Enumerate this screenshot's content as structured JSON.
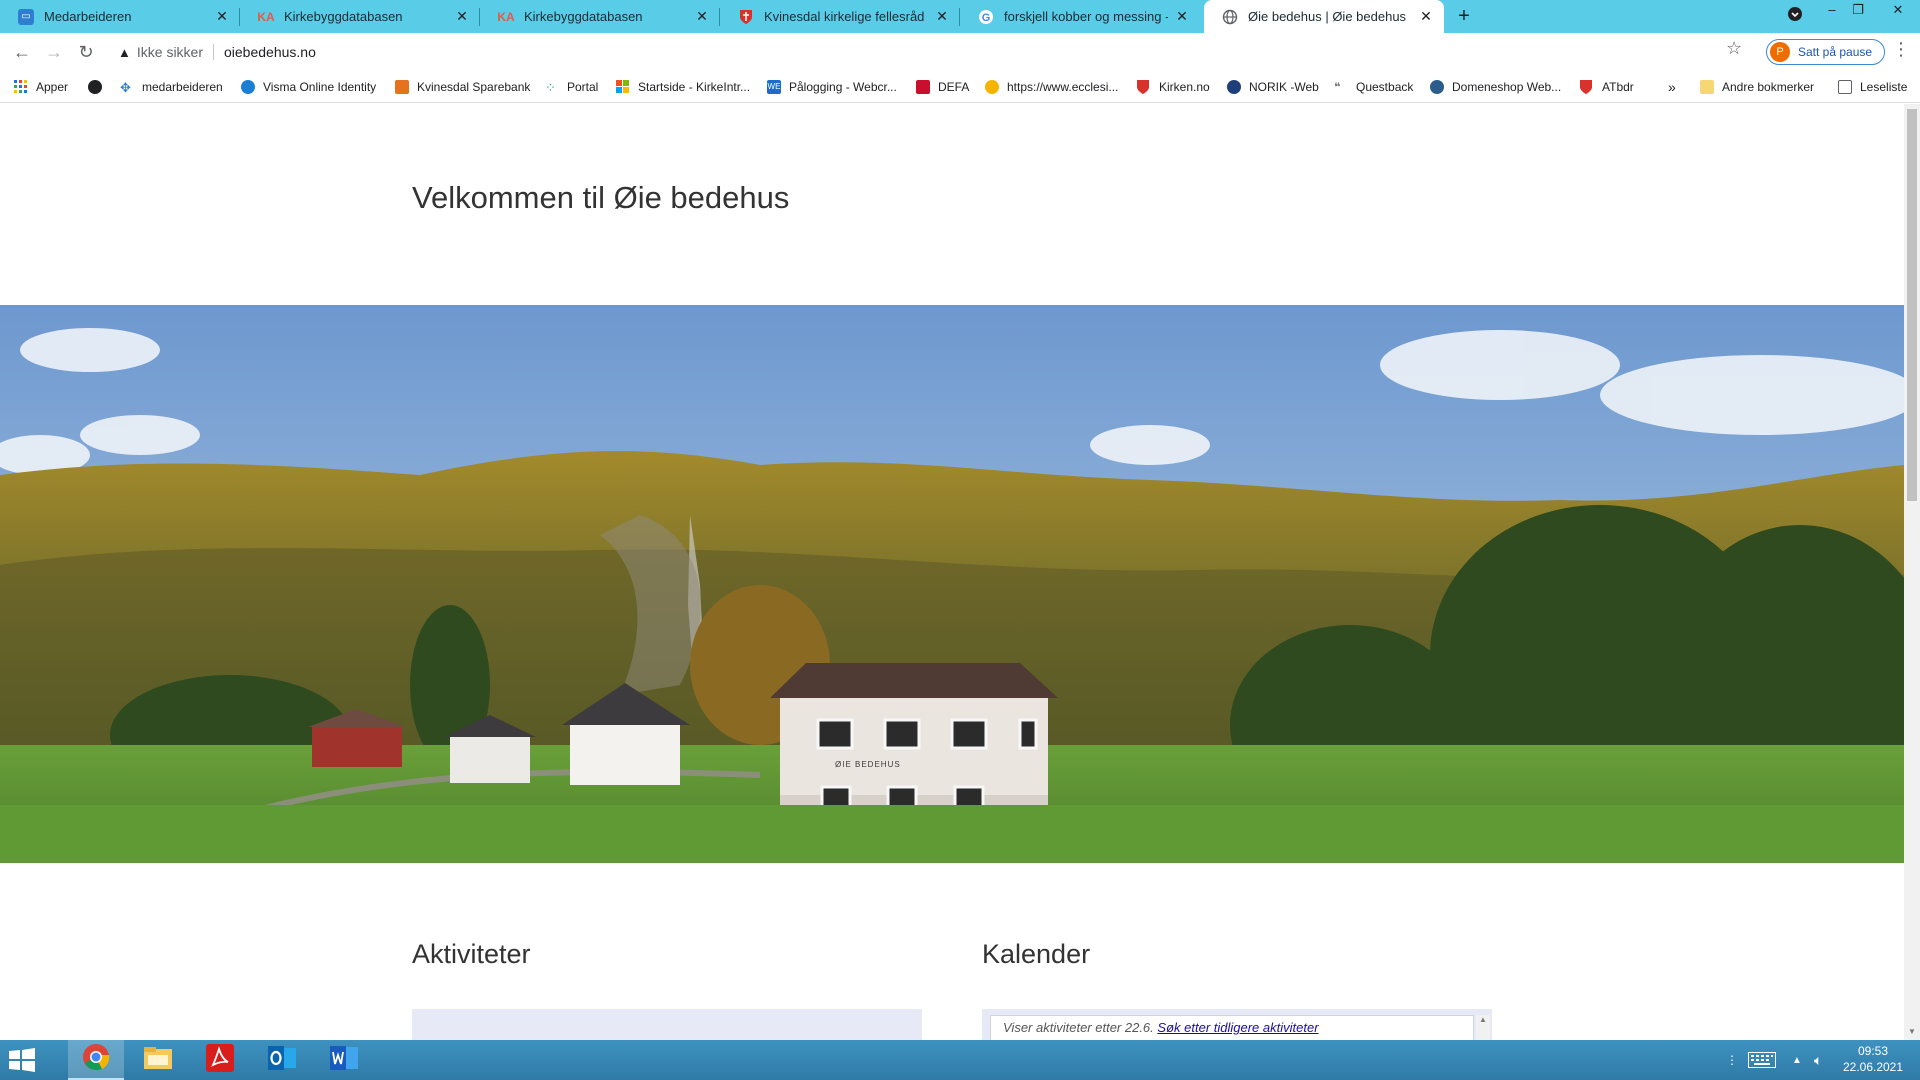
{
  "browser": {
    "tabs": [
      {
        "title": "Medarbeideren",
        "favicon": "medarbeideren-icon",
        "color": "#2f7fd1"
      },
      {
        "title": "Kirkebyggdatabasen",
        "favicon": "ka-icon",
        "color": "#e25a4e"
      },
      {
        "title": "Kirkebyggdatabasen",
        "favicon": "ka-icon",
        "color": "#e25a4e"
      },
      {
        "title": "Kvinesdal kirkelige fellesråd > Me",
        "favicon": "church-shield-icon",
        "color": "#d9312b"
      },
      {
        "title": "forskjell kobber og messing - Go",
        "favicon": "google-icon",
        "color": "#4285f4"
      },
      {
        "title": "Øie bedehus | Øie bedehus",
        "favicon": "globe-icon",
        "color": "#5f6368"
      }
    ],
    "active_tab_index": 5,
    "window_controls": {
      "minimize": "–",
      "restore": "❐",
      "close": "✕"
    },
    "security_label": "Ikke sikker",
    "url": "oiebedehus.no",
    "profile": {
      "initial": "P",
      "label": "Satt på pause"
    },
    "bookmarks": [
      {
        "label": "Apper",
        "icon": "apps-grid-icon"
      },
      {
        "label": "",
        "icon": "globe-dark-icon"
      },
      {
        "label": "medarbeideren",
        "icon": "medarbeideren-icon"
      },
      {
        "label": "Visma Online Identity",
        "icon": "visma-icon"
      },
      {
        "label": "Kvinesdal Sparebank",
        "icon": "bank-icon"
      },
      {
        "label": "Portal",
        "icon": "portal-icon"
      },
      {
        "label": "Startside - KirkeIntr...",
        "icon": "windows-tiles-icon"
      },
      {
        "label": "Pålogging - Webcr...",
        "icon": "webcruiter-icon"
      },
      {
        "label": "DEFA",
        "icon": "defa-icon"
      },
      {
        "label": "https://www.ecclesi...",
        "icon": "ecclesi-icon"
      },
      {
        "label": "Kirken.no",
        "icon": "church-shield-icon"
      },
      {
        "label": "NORIK -Web",
        "icon": "norik-icon"
      },
      {
        "label": "Questback",
        "icon": "questback-icon"
      },
      {
        "label": "Domeneshop Web...",
        "icon": "domeneshop-icon"
      },
      {
        "label": "ATbdr",
        "icon": "church-shield-icon"
      }
    ],
    "overflow": "»",
    "other_bookmarks": "Andre bokmerker",
    "reading_list": "Leseliste"
  },
  "page": {
    "title": "Velkommen til Øie bedehus",
    "hero_sign": "ØIE BEDEHUS",
    "activities_heading": "Aktiviteter",
    "calendar_heading": "Kalender",
    "calendar_notice": "Viser aktiviteter etter 22.6.",
    "calendar_link": "Søk etter tidligere aktiviteter"
  },
  "taskbar": {
    "apps": [
      "chrome-icon",
      "file-explorer-icon",
      "acrobat-icon",
      "outlook-icon",
      "word-icon"
    ],
    "time": "09:53",
    "date": "22.06.2021"
  }
}
